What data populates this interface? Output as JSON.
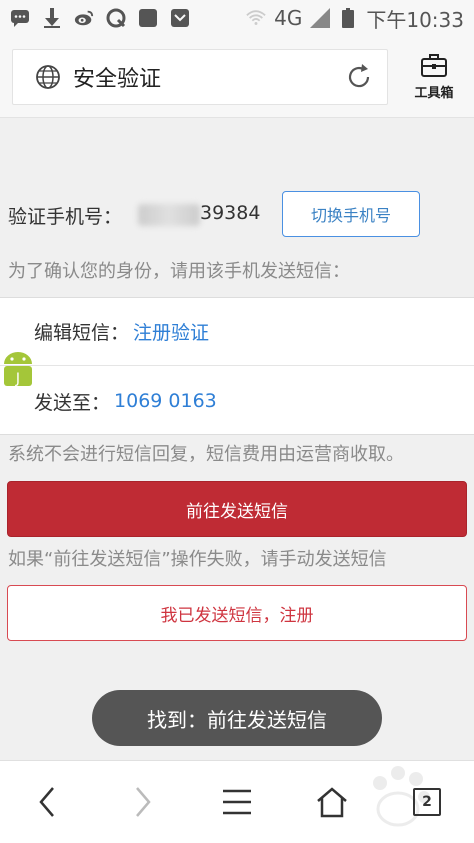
{
  "status_bar": {
    "network": "4G",
    "time": "下午10:33",
    "icons": [
      "chat-icon",
      "download-icon",
      "weibo-icon",
      "q-icon",
      "app-icon",
      "mail-icon",
      "wifi-icon",
      "signal-icon",
      "battery-icon"
    ]
  },
  "header": {
    "title": "安全验证",
    "toolbox_label": "工具箱"
  },
  "content": {
    "verify_label": "验证手机号：",
    "phone_visible": "39384",
    "switch_button": "切换手机号",
    "hint": "为了确认您的身份，请用该手机发送短信：",
    "sms": {
      "edit_key": "编辑短信：",
      "edit_value": "注册验证",
      "send_key": "发送至：",
      "send_value": "1069 0163"
    },
    "notice": "系统不会进行短信回复，短信费用由运营商收取。",
    "primary_button": "前往发送短信",
    "fallback_hint": "如果“前往发送短信”操作失败，请手动发送短信",
    "secondary_button": "我已发送短信，注册"
  },
  "toast": {
    "text": "找到：前往发送短信"
  },
  "bottom_nav": {
    "tab_count": "2"
  },
  "colors": {
    "primary": "#bf2b34",
    "link": "#2f7fd6",
    "accent_border": "#4a90e2"
  }
}
